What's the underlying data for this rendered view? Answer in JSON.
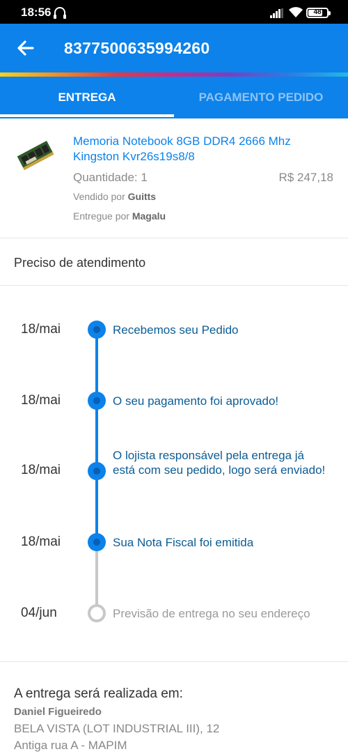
{
  "status_bar": {
    "time": "18:56",
    "battery": "48"
  },
  "app_bar": {
    "title": "8377500635994260",
    "back_icon": "arrow-left-icon"
  },
  "tabs": [
    {
      "label": "ENTREGA",
      "active": true
    },
    {
      "label": "PAGAMENTO PEDIDO",
      "active": false
    }
  ],
  "product": {
    "name": "Memoria Notebook 8GB DDR4 2666 Mhz Kingston Kvr26s19s8/8",
    "quantity": "Quantidade: 1",
    "price": "R$ 247,18",
    "seller_label": "Vendido por",
    "seller": "Guitts",
    "deliverer_label": "Entregue por",
    "deliverer": "Magalu"
  },
  "help": {
    "label": "Preciso de atendimento"
  },
  "timeline": [
    {
      "date": "18/mai",
      "text": "Recebemos seu Pedido",
      "done": true
    },
    {
      "date": "18/mai",
      "text": "O seu pagamento foi aprovado!",
      "done": true
    },
    {
      "date": "18/mai",
      "text": "O lojista responsável pela entrega já está com seu pedido, logo será enviado!",
      "done": true
    },
    {
      "date": "18/mai",
      "text": "Sua Nota Fiscal foi emitida",
      "done": true
    },
    {
      "date": "04/jun",
      "text": "Previsão de entrega no seu endereço",
      "done": false
    }
  ],
  "address": {
    "title": "A entrega será realizada em:",
    "name": "Daniel Figueiredo",
    "line1": "BELA VISTA (LOT INDUSTRIAL III), 12",
    "line2": "Antiga rua A - MAPIM"
  },
  "colors": {
    "primary": "#0c82ea",
    "timeline_text": "#0c5c94",
    "inactive": "#c8c8c8"
  }
}
